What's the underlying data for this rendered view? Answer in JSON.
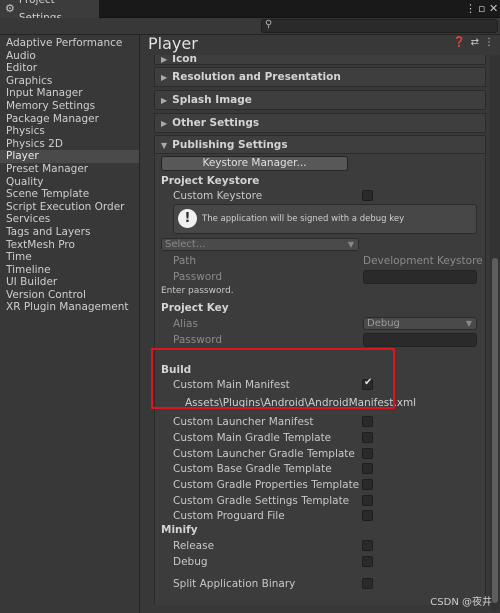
{
  "window": {
    "tab_title": "Project Settings",
    "gear_icon": "gear-icon"
  },
  "sidebar": {
    "items": [
      {
        "label": "Adaptive Performance"
      },
      {
        "label": "Audio"
      },
      {
        "label": "Editor"
      },
      {
        "label": "Graphics"
      },
      {
        "label": "Input Manager"
      },
      {
        "label": "Memory Settings"
      },
      {
        "label": "Package Manager"
      },
      {
        "label": "Physics"
      },
      {
        "label": "Physics 2D"
      },
      {
        "label": "Player",
        "selected": true
      },
      {
        "label": "Preset Manager"
      },
      {
        "label": "Quality"
      },
      {
        "label": "Scene Template"
      },
      {
        "label": "Script Execution Order"
      },
      {
        "label": "Services"
      },
      {
        "label": "Tags and Layers"
      },
      {
        "label": "TextMesh Pro"
      },
      {
        "label": "Time"
      },
      {
        "label": "Timeline"
      },
      {
        "label": "UI Builder"
      },
      {
        "label": "Version Control"
      },
      {
        "label": "XR Plugin Management"
      }
    ]
  },
  "main": {
    "title": "Player",
    "sections": {
      "icon": "Icon",
      "resolution": "Resolution and Presentation",
      "splash": "Splash Image",
      "other": "Other Settings",
      "publishing": "Publishing Settings"
    },
    "publishing": {
      "keystore_manager_button": "Keystore Manager...",
      "project_keystore": "Project Keystore",
      "custom_keystore": "Custom Keystore",
      "custom_keystore_checked": false,
      "info_text": "The application will be signed with a debug key",
      "select_placeholder": "Select...",
      "path_label": "Path",
      "path_value": "Development Keystore",
      "password_label": "Password",
      "enter_password": "Enter password.",
      "project_key": "Project Key",
      "alias_label": "Alias",
      "alias_value": "Debug",
      "key_password_label": "Password"
    },
    "build": {
      "header": "Build",
      "items": [
        {
          "label": "Custom Main Manifest",
          "checked": true
        },
        {
          "label": "Custom Launcher Manifest",
          "checked": false
        },
        {
          "label": "Custom Main Gradle Template",
          "checked": false
        },
        {
          "label": "Custom Launcher Gradle Template",
          "checked": false
        },
        {
          "label": "Custom Base Gradle Template",
          "checked": false
        },
        {
          "label": "Custom Gradle Properties Template",
          "checked": false
        },
        {
          "label": "Custom Gradle Settings Template",
          "checked": false
        },
        {
          "label": "Custom Proguard File",
          "checked": false
        }
      ],
      "manifest_path": "Assets\\Plugins\\Android\\AndroidManifest.xml"
    },
    "minify": {
      "header": "Minify",
      "release": "Release",
      "debug": "Debug"
    },
    "split_binary": "Split Application Binary"
  },
  "watermark": "CSDN @夜井"
}
